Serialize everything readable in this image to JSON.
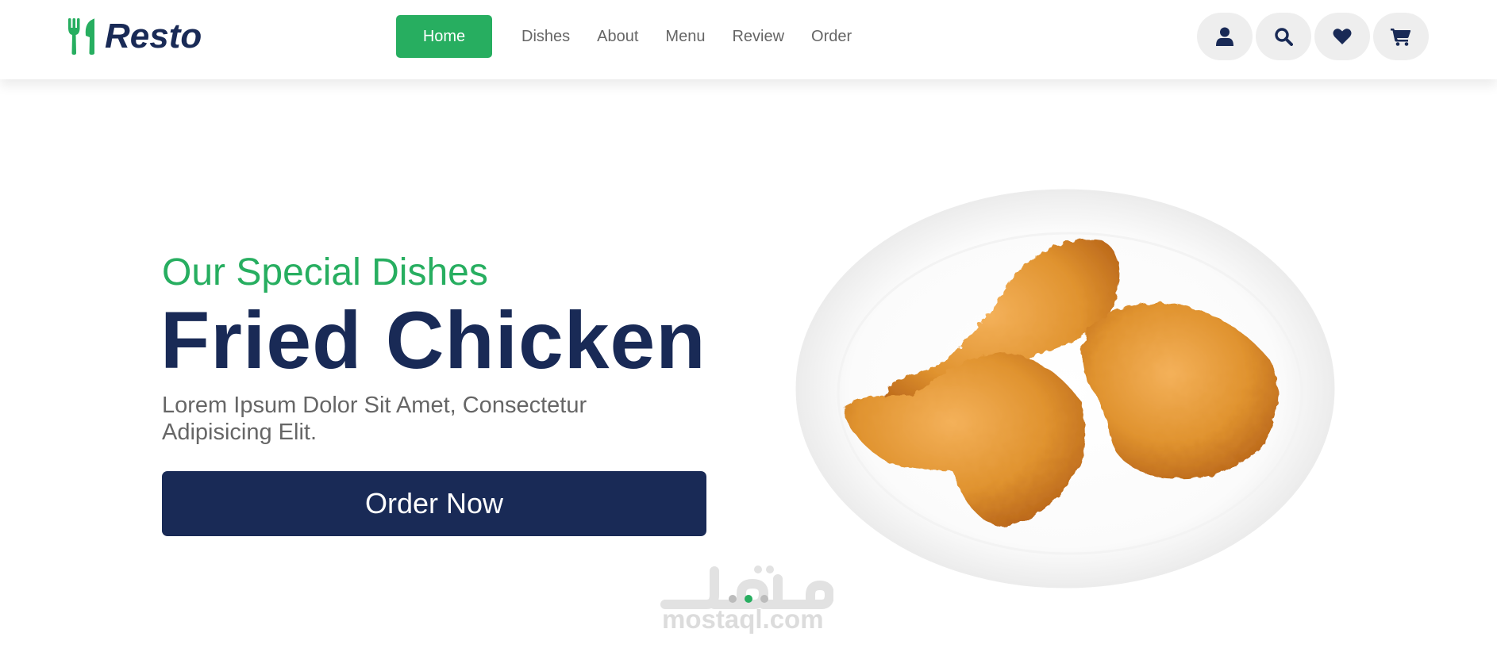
{
  "brand": {
    "name": "Resto",
    "icon": "utensils-icon",
    "accent": "#27ae60",
    "dark": "#192a56"
  },
  "nav": {
    "items": [
      {
        "label": "Home",
        "active": true
      },
      {
        "label": "Dishes",
        "active": false
      },
      {
        "label": "About",
        "active": false
      },
      {
        "label": "Menu",
        "active": false
      },
      {
        "label": "Review",
        "active": false
      },
      {
        "label": "Order",
        "active": false
      }
    ]
  },
  "header_icons": [
    "user-icon",
    "search-icon",
    "heart-icon",
    "cart-icon"
  ],
  "hero": {
    "subtitle": "Our Special Dishes",
    "title": "Fried Chicken",
    "description": "Lorem Ipsum Dolor Sit Amet, Consectetur Adipisicing Elit.",
    "button_label": "Order Now",
    "image": "fried-chicken-plate"
  },
  "slider": {
    "count": 3,
    "active_index": 1
  },
  "watermark": {
    "text": "mostaql.com",
    "arabic": "مستقل"
  }
}
